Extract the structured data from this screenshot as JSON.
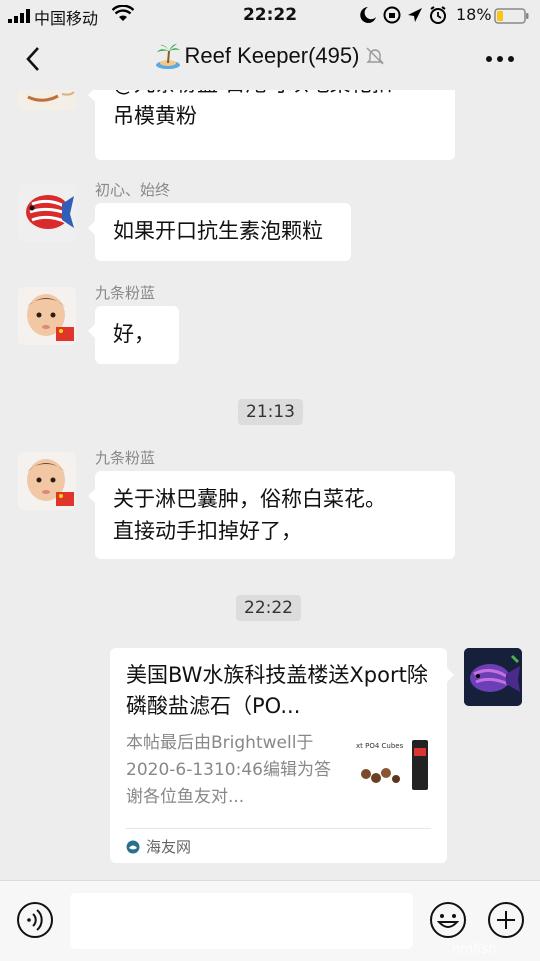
{
  "status_bar": {
    "carrier": "中国移动",
    "time": "22:22",
    "battery": "18%",
    "icons": [
      "signal-icon",
      "wifi-icon",
      "moon-icon",
      "rotation-lock-icon",
      "location-icon",
      "alarm-icon",
      "battery-icon"
    ]
  },
  "header": {
    "title": "Reef Keeper(495)",
    "title_emoji": "island-icon",
    "muted_icon": "bell-off-icon",
    "back_icon": "chevron-left-icon",
    "more_icon": "more-dots-icon"
  },
  "messages": [
    {
      "type": "text",
      "side": "left",
      "sender": "",
      "avatar": "fish-avatar",
      "text_lines": [
        "@九条粉蓝 日尾可以吧菜花扣",
        "吊模黄粉"
      ]
    },
    {
      "type": "text",
      "side": "left",
      "sender": "初心、始终",
      "avatar": "red-fish-avatar",
      "text_lines": [
        "如果开口抗生素泡颗粒"
      ]
    },
    {
      "type": "text",
      "side": "left",
      "sender": "九条粉蓝",
      "avatar": "baby-avatar",
      "text_lines": [
        "好，"
      ]
    },
    {
      "type": "time",
      "text": "21:13"
    },
    {
      "type": "text",
      "side": "left",
      "sender": "九条粉蓝",
      "avatar": "baby-avatar",
      "text_lines": [
        "关于淋巴囊肿，俗称白菜花。",
        "直接动手扣掉好了，"
      ]
    },
    {
      "type": "time",
      "text": "22:22"
    },
    {
      "type": "link",
      "side": "right",
      "avatar": "purple-fish-avatar",
      "title": "美国BW水族科技盖楼送Xport除磷酸盐滤石（PO...",
      "description": "本帖最后由Brightwell于2020-6-1310:46编辑为答谢各位鱼友对...",
      "thumb_text": "xt PO4 Cubes",
      "source": "海友网"
    }
  ],
  "input_bar": {
    "voice_icon": "voice-icon",
    "emoji_icon": "emoji-icon",
    "plus_icon": "plus-icon",
    "text_value": ""
  },
  "watermark": "nmfish",
  "colors": {
    "background": "#ededed",
    "bubble": "#ffffff",
    "battery_low": "#f5c518",
    "flag": "#e0352b"
  }
}
